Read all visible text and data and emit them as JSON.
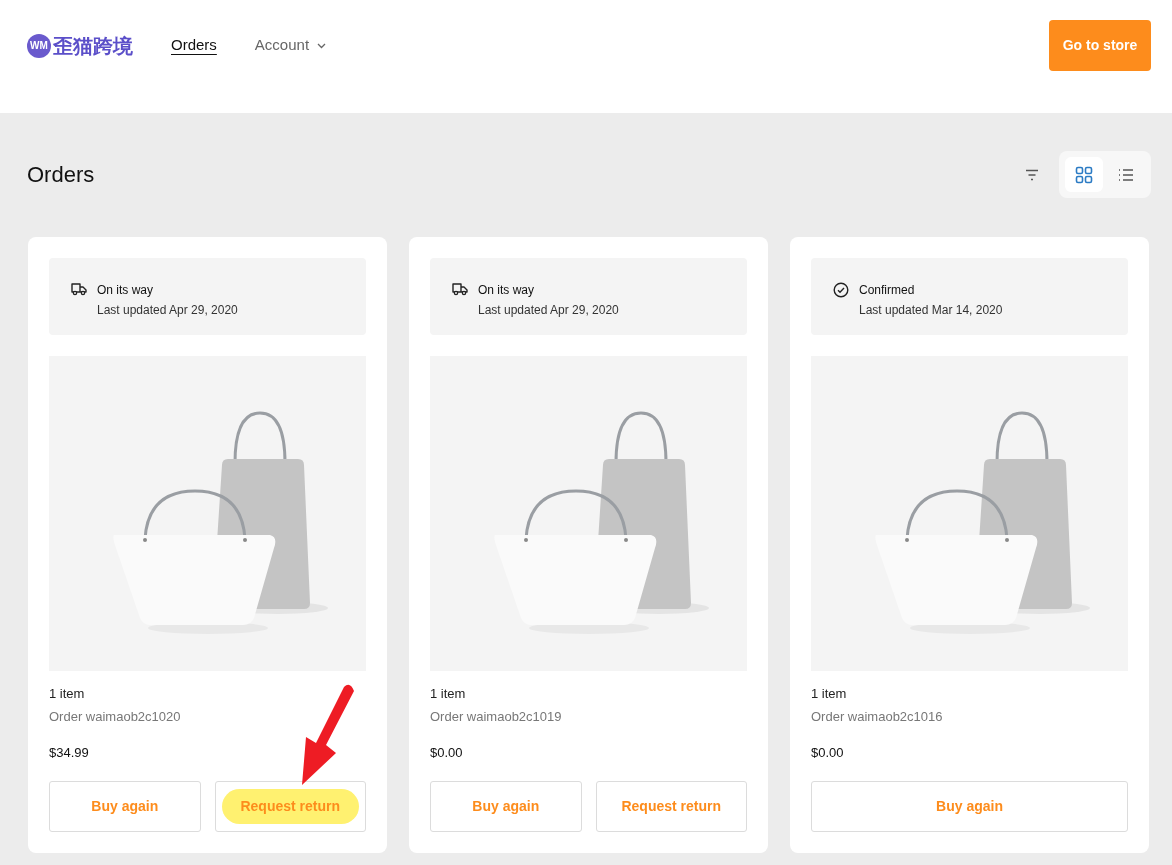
{
  "header": {
    "logo_mark": "WM",
    "logo_text": "歪猫跨境",
    "nav": [
      {
        "label": "Orders",
        "selected": true,
        "dropdown": false
      },
      {
        "label": "Account",
        "selected": false,
        "dropdown": true
      }
    ],
    "store_button": "Go to store"
  },
  "page": {
    "title": "Orders",
    "views": [
      {
        "kind": "grid",
        "selected": true
      },
      {
        "kind": "list",
        "selected": false
      }
    ]
  },
  "orders": [
    {
      "kind": "shipping",
      "status": "On its way",
      "updated": "Last updated Apr 29, 2020",
      "items": "1 item",
      "order": "Order waimaob2c1020",
      "price": "$34.99",
      "buttons": [
        {
          "label": "Buy again",
          "highlighted": false
        },
        {
          "label": "Request return",
          "highlighted": true
        }
      ]
    },
    {
      "kind": "shipping",
      "status": "On its way",
      "updated": "Last updated Apr 29, 2020",
      "items": "1 item",
      "order": "Order waimaob2c1019",
      "price": "$0.00",
      "buttons": [
        {
          "label": "Buy again",
          "highlighted": false
        },
        {
          "label": "Request return",
          "highlighted": false
        }
      ]
    },
    {
      "kind": "confirmed",
      "status": "Confirmed",
      "updated": "Last updated Mar 14, 2020",
      "items": "1 item",
      "order": "Order waimaob2c1016",
      "price": "$0.00",
      "buttons": [
        {
          "label": "Buy again",
          "highlighted": false
        }
      ]
    }
  ]
}
